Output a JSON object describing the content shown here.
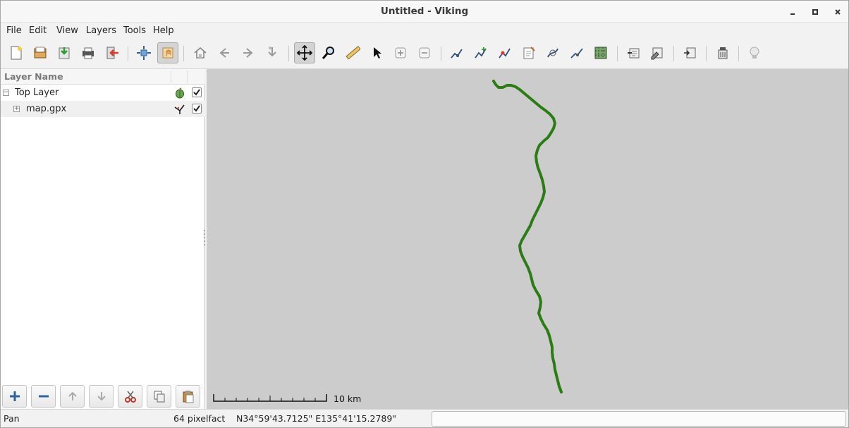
{
  "window": {
    "title": "Untitled - Viking",
    "minimize_icon": "minimize-icon",
    "maximize_icon": "maximize-icon",
    "close_icon": "close-icon"
  },
  "menubar": {
    "items": [
      "File",
      "Edit",
      "View",
      "Layers",
      "Tools",
      "Help"
    ]
  },
  "toolbar": {
    "buttons": [
      "new-file-icon",
      "open-file-icon",
      "save-file-icon",
      "print-icon",
      "exit-icon",
      "zoom-to-fit-icon",
      "pan-hand-icon",
      "home-icon",
      "back-icon",
      "forward-icon",
      "jump-icon",
      "pan-tool-icon",
      "zoom-tool-icon",
      "ruler-icon",
      "select-icon",
      "zoom-in-icon",
      "zoom-out-icon",
      "edit-trackpoint-icon",
      "create-track-icon",
      "create-waypoint-icon",
      "edit-waypoint-icon",
      "route-finder-icon",
      "splitter-icon",
      "map-download-icon",
      "layer-properties-icon",
      "layer-edit-icon",
      "layer-list-icon",
      "layer-delete-icon",
      "tip-bulb-icon"
    ],
    "toggled": [
      "pan-hand-icon",
      "pan-tool-icon"
    ]
  },
  "layers_panel": {
    "header": "Layer Name",
    "rows": [
      {
        "label": "Top Layer",
        "expander": "−",
        "icon": "aggregate-layer-icon",
        "visible": true
      },
      {
        "label": "map.gpx",
        "expander": "+",
        "icon": "trw-layer-icon",
        "visible": true
      }
    ],
    "buttons": [
      "add-layer-icon",
      "remove-layer-icon",
      "move-up-icon",
      "move-down-icon",
      "cut-icon",
      "copy-icon",
      "paste-icon"
    ]
  },
  "map": {
    "background": "#cccccc",
    "track_color": "#2a7d13",
    "scale_label": "10 km"
  },
  "statusbar": {
    "tool": "Pan",
    "zoom": "64 pixelfact",
    "coordinates": "N34°59'43.7125\" E135°41'15.2789\""
  }
}
